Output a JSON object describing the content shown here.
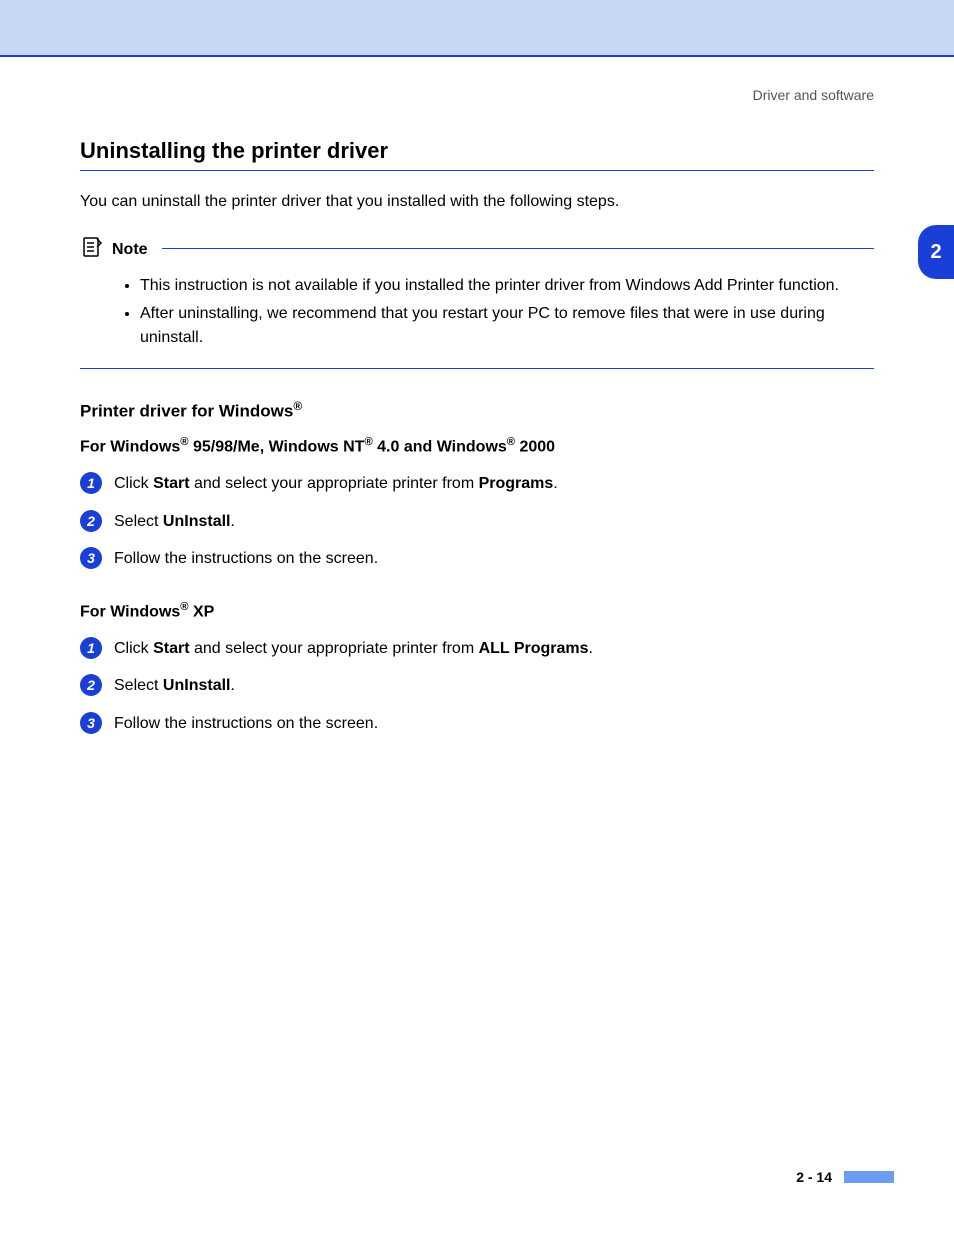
{
  "header": {
    "breadcrumb": "Driver and software"
  },
  "chapter_tab": "2",
  "section": {
    "title": "Uninstalling the printer driver",
    "intro": "You can uninstall the printer driver that you installed with the following steps."
  },
  "note": {
    "label": "Note",
    "items": [
      "This instruction is not available if you installed the printer driver from Windows Add Printer function.",
      "After uninstalling, we recommend that you restart your PC to remove files that were in use during uninstall."
    ]
  },
  "sections": [
    {
      "heading_html": "Printer driver for Windows<sup>®</sup>",
      "sub_html": "For Windows<sup>®</sup> 95/98/Me, Windows NT<sup>®</sup> 4.0 and Windows<sup>®</sup> 2000",
      "steps": [
        "Click <b>Start</b> and select your appropriate printer from <b>Programs</b>.",
        "Select <b>UnInstall</b>.",
        "Follow the instructions on the screen."
      ]
    },
    {
      "sub_html": "For Windows<sup>®</sup> XP",
      "steps": [
        "Click <b>Start</b> and select your appropriate printer from <b>ALL Programs</b>.",
        "Select <b>UnInstall</b>.",
        "Follow the instructions on the screen."
      ]
    }
  ],
  "footer": {
    "page": "2 - 14"
  }
}
